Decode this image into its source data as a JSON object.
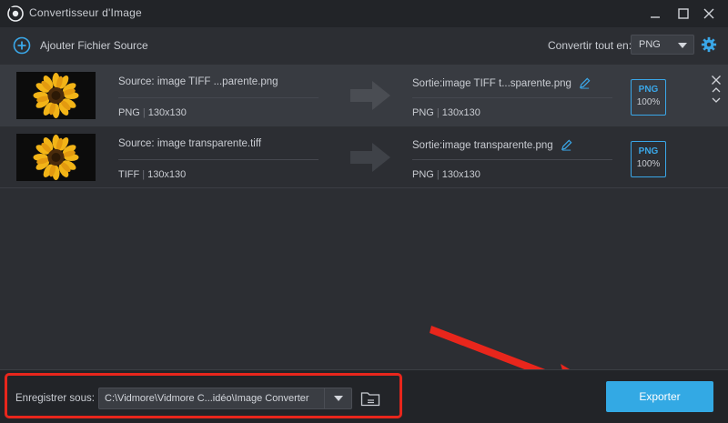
{
  "window": {
    "title": "Convertisseur d'Image"
  },
  "toolbar": {
    "add_label": "Ajouter Fichier Source",
    "convert_all_label": "Convertir tout en:",
    "convert_all_value": "PNG"
  },
  "files": [
    {
      "source_name": "Source: image TIFF ...parente.png",
      "source_format": "PNG",
      "source_size": "130x130",
      "output_name": "Sortie:image TIFF t...sparente.png",
      "output_format": "PNG",
      "output_size": "130x130",
      "badge_format": "PNG",
      "badge_quality": "100%"
    },
    {
      "source_name": "Source: image transparente.tiff",
      "source_format": "TIFF",
      "source_size": "130x130",
      "output_name": "Sortie:image transparente.png",
      "output_format": "PNG",
      "output_size": "130x130",
      "badge_format": "PNG",
      "badge_quality": "100%"
    }
  ],
  "bottom": {
    "save_label": "Enregistrer sous:",
    "path": "C:\\Vidmore\\Vidmore C...idéo\\Image Converter",
    "export_label": "Exporter"
  },
  "colors": {
    "accent": "#33a9e4",
    "highlight": "#e8261c",
    "background": "#2c2e33"
  },
  "icons": {
    "app": "app-logo-icon",
    "add": "plus-circle-icon",
    "settings": "gear-icon",
    "arrow": "right-arrow-icon",
    "edit": "pencil-icon",
    "folder": "folder-icon"
  }
}
